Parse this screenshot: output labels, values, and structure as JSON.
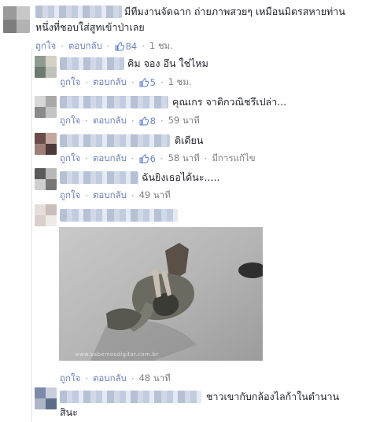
{
  "colors": {
    "link": "#6d84b4",
    "meta": "#7f7f7f",
    "thumb": "#5b7bd5",
    "text": "#1d2129"
  },
  "comments": [
    {
      "text": "มีทีมงานจัดฉาก ถ่ายภาพสวยๆ เหมือนมิตรสหายท่าน",
      "text2": "หนึ่งที่ชอบใส่สูทเข้าป่าเลย",
      "like": "ถูกใจ",
      "reply": "ตอบกลับ",
      "likes": "84",
      "time": "1 ชม."
    },
    {
      "text": "คิม จอง อึน ใช่ไหม",
      "like": "ถูกใจ",
      "reply": "ตอบกลับ",
      "likes": "5",
      "time": "1 ชม."
    },
    {
      "text": "คุณเกร จาติกวณิชรึเปล่า...",
      "like": "ถูกใจ",
      "reply": "ตอบกลับ",
      "likes": "8",
      "time": "59 นาที"
    },
    {
      "text": "ติเดียน",
      "like": "ถูกใจ",
      "reply": "ตอบกลับ",
      "likes": "6",
      "time": "58 นาที",
      "edited": "มีการแก้ไข"
    },
    {
      "text": "ฉันยิงเธอได้นะ.....",
      "like": "ถูกใจ",
      "reply": "ตอบกลับ",
      "time": "49 นาที"
    },
    {
      "photo_caption": "www.sabemosdigitar.com.br",
      "like": "ถูกใจ",
      "reply": "ตอบกลับ",
      "time": "48 นาที"
    },
    {
      "text": "ชาวเขากับกล้องไลก้าในตำนาน",
      "text2": "สินะ"
    }
  ]
}
